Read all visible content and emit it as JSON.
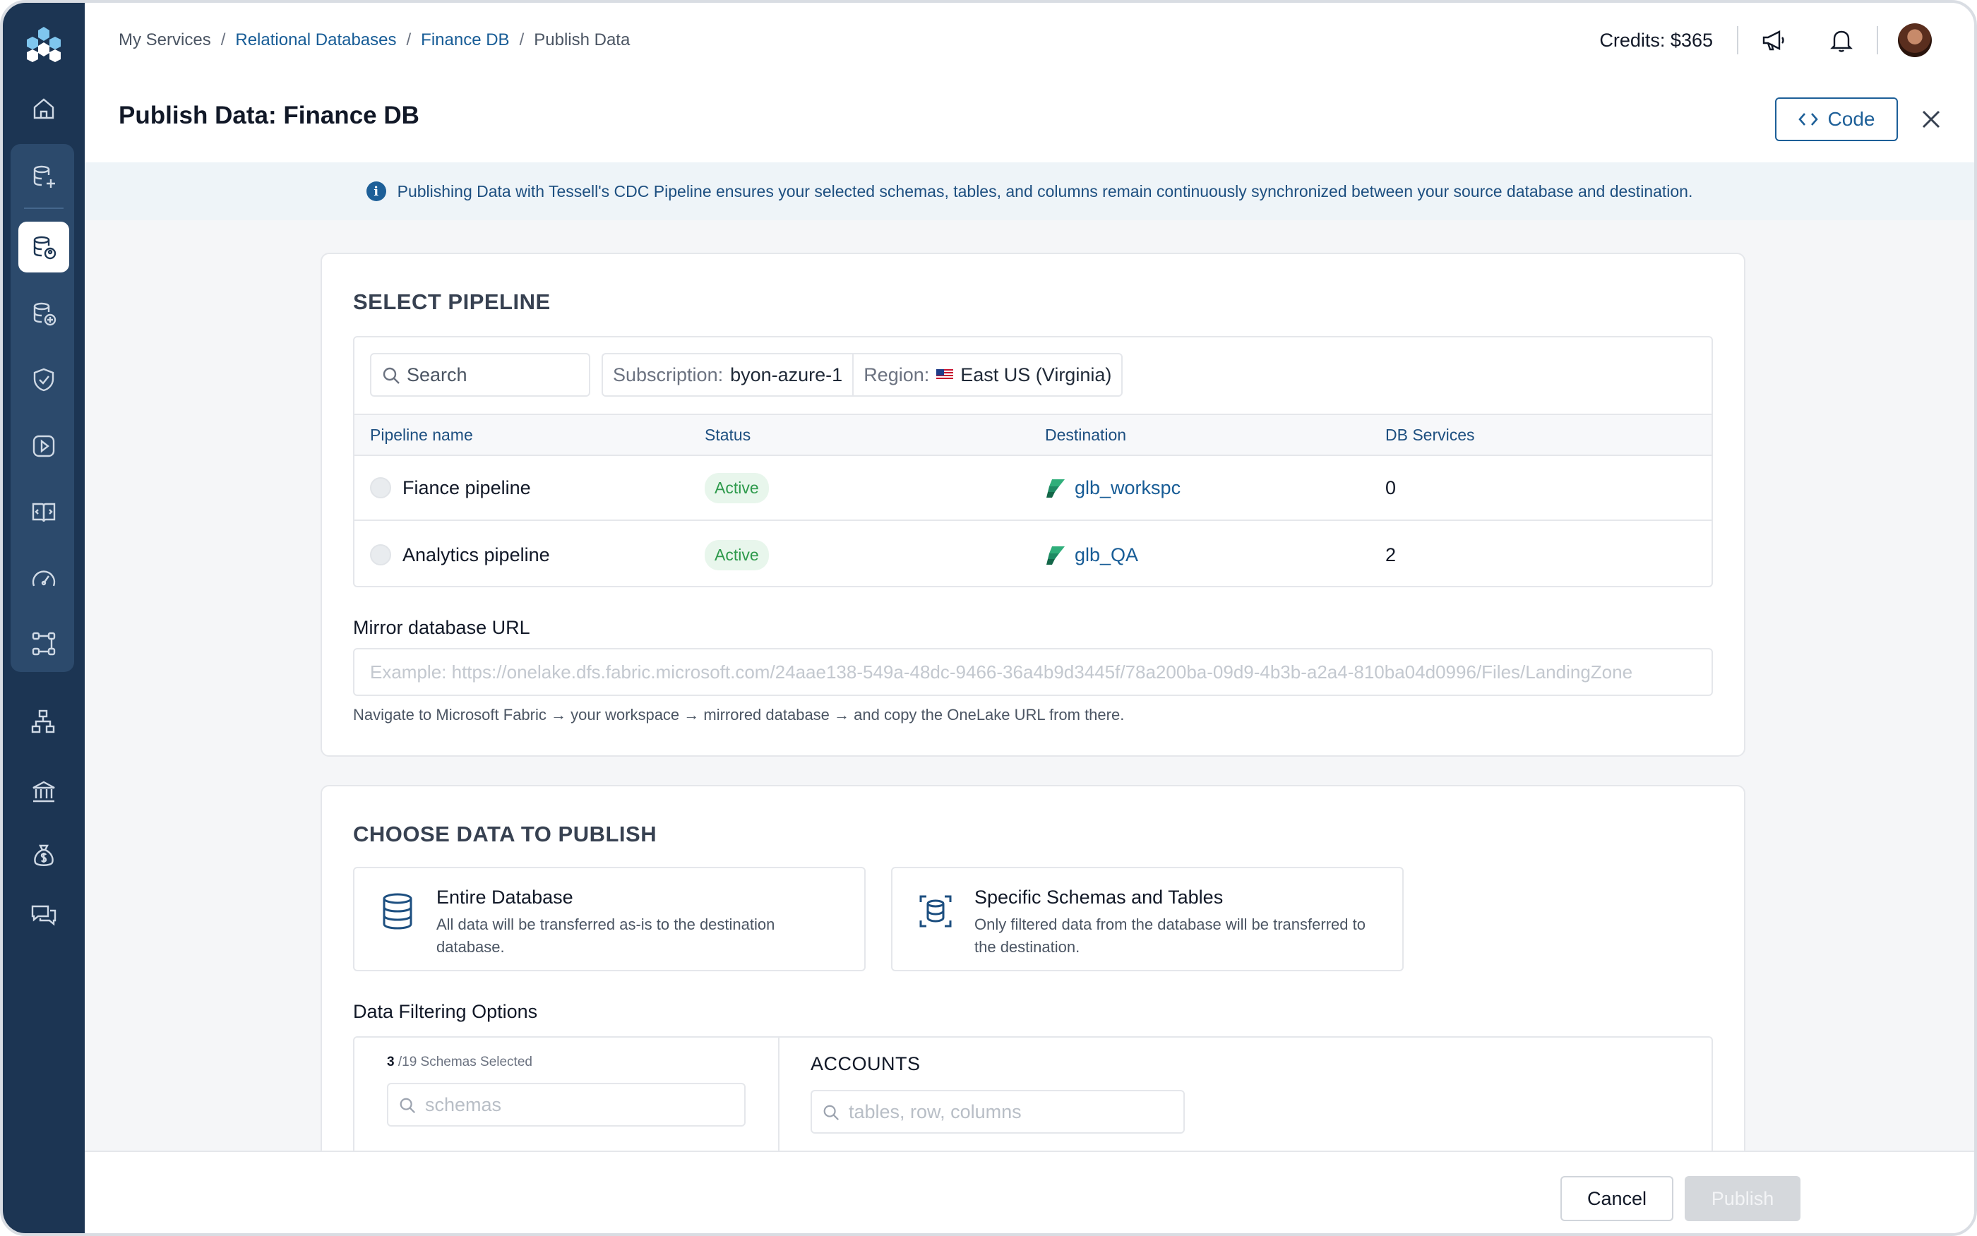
{
  "breadcrumb": [
    {
      "label": "My Services",
      "link": false
    },
    {
      "label": "Relational Databases",
      "link": true
    },
    {
      "label": "Finance DB",
      "link": true
    },
    {
      "label": "Publish Data",
      "link": false
    }
  ],
  "topbar": {
    "credits": "Credits: $365"
  },
  "header": {
    "title": "Publish Data: Finance DB",
    "code_label": "Code"
  },
  "info_banner": "Publishing Data with Tessell's CDC Pipeline ensures your selected schemas, tables, and columns remain continuously synchronized between your source database and destination.",
  "select_pipeline": {
    "title": "SELECT PIPELINE",
    "search_placeholder": "Search",
    "filters": {
      "subscription_key": "Subscription:",
      "subscription_value": "byon-azure-1",
      "region_key": "Region:",
      "region_value": "East US (Virginia)"
    },
    "columns": [
      "Pipeline name",
      "Status",
      "Destination",
      "DB Services"
    ],
    "rows": [
      {
        "name": "Fiance pipeline",
        "status": "Active",
        "destination": "glb_workspc",
        "db_services": "0"
      },
      {
        "name": "Analytics pipeline",
        "status": "Active",
        "destination": "glb_QA",
        "db_services": "2"
      }
    ],
    "mirror_label": "Mirror database URL",
    "mirror_placeholder": "Example: https://onelake.dfs.fabric.microsoft.com/24aae138-549a-48dc-9466-36a4b9d3445f/78a200ba-09d9-4b3b-a2a4-810ba04d0996/Files/LandingZone",
    "mirror_hint": "Navigate to Microsoft Fabric → your workspace → mirrored database → and copy the OneLake URL from there."
  },
  "choose_data": {
    "title": "CHOOSE DATA TO PUBLISH",
    "options": [
      {
        "title": "Entire Database",
        "desc": "All data will be transferred as-is to the destination database."
      },
      {
        "title": "Specific Schemas and Tables",
        "desc": "Only filtered data from the database will be transferred to the destination."
      }
    ],
    "filtering_label": "Data Filtering Options",
    "selected_count": "3",
    "selected_total": "/19 Schemas Selected",
    "schemas_placeholder": "schemas",
    "accounts_title": "ACCOUNTS",
    "tables_placeholder": "tables, row, columns"
  },
  "footer": {
    "cancel": "Cancel",
    "publish": "Publish"
  },
  "colors": {
    "sidebar": "#1c3553",
    "accent": "#1d5f98",
    "active_badge": "#2e9a4c"
  }
}
